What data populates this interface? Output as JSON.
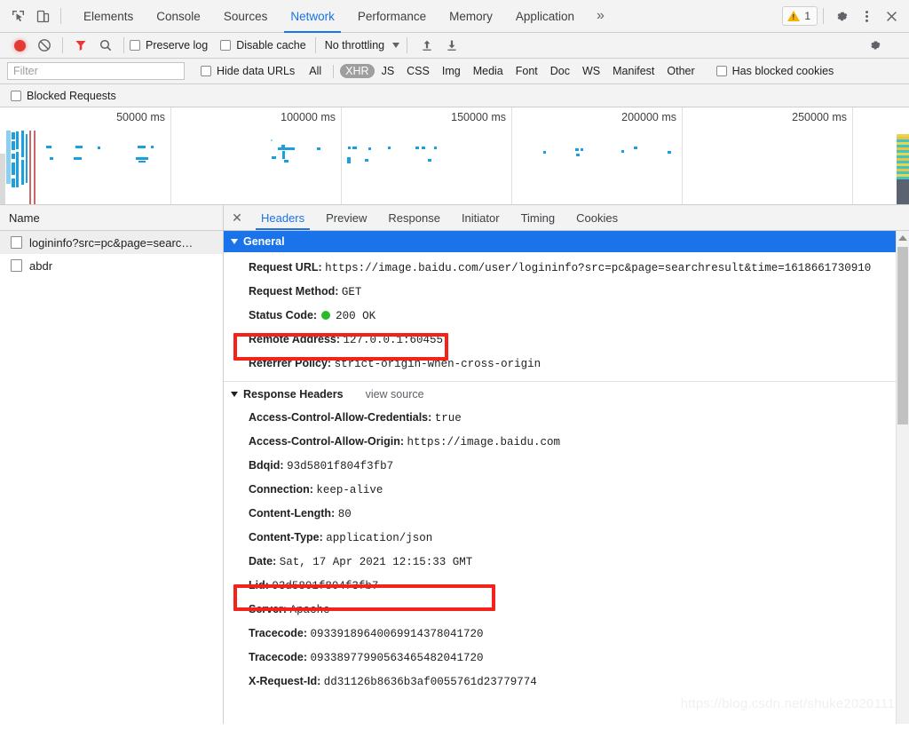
{
  "tabbar": {
    "icons": [
      "inspect-element-icon",
      "device-toolbar-icon"
    ],
    "tabs": [
      {
        "label": "Elements",
        "active": false
      },
      {
        "label": "Console",
        "active": false
      },
      {
        "label": "Sources",
        "active": false
      },
      {
        "label": "Network",
        "active": true
      },
      {
        "label": "Performance",
        "active": false
      },
      {
        "label": "Memory",
        "active": false
      },
      {
        "label": "Application",
        "active": false
      }
    ],
    "more_label": "»",
    "warning_count": "1",
    "settings_label": "⚙",
    "kebab_label": "⋮",
    "close_label": "✕"
  },
  "controls": {
    "record_title": "record-button",
    "clear_title": "clear-button",
    "filter_title": "filter-button",
    "search_title": "search-button",
    "preserve_log": "Preserve log",
    "disable_cache": "Disable cache",
    "throttling": "No throttling",
    "import_title": "import-har",
    "export_title": "export-har",
    "settings_title": "network-settings"
  },
  "filterbar": {
    "placeholder": "Filter",
    "value": "",
    "hide_data_urls": "Hide data URLs",
    "types": [
      {
        "label": "All",
        "selected": false
      },
      {
        "label": "XHR",
        "selected": true
      },
      {
        "label": "JS",
        "selected": false
      },
      {
        "label": "CSS",
        "selected": false
      },
      {
        "label": "Img",
        "selected": false
      },
      {
        "label": "Media",
        "selected": false
      },
      {
        "label": "Font",
        "selected": false
      },
      {
        "label": "Doc",
        "selected": false
      },
      {
        "label": "WS",
        "selected": false
      },
      {
        "label": "Manifest",
        "selected": false
      },
      {
        "label": "Other",
        "selected": false
      }
    ],
    "has_blocked_cookies": "Has blocked cookies",
    "blocked_requests": "Blocked Requests"
  },
  "overview": {
    "ticks": [
      "50000 ms",
      "100000 ms",
      "150000 ms",
      "200000 ms",
      "250000 ms"
    ],
    "bar_color": "#1a9fe0",
    "marker_color": "#b33333"
  },
  "requests": {
    "column_header": "Name",
    "rows": [
      {
        "name": "logininfo?src=pc&page=searc…",
        "selected": true
      },
      {
        "name": "abdr",
        "selected": false
      }
    ]
  },
  "detail": {
    "close_label": "✕",
    "tabs": [
      {
        "label": "Headers",
        "active": true
      },
      {
        "label": "Preview",
        "active": false
      },
      {
        "label": "Response",
        "active": false
      },
      {
        "label": "Initiator",
        "active": false
      },
      {
        "label": "Timing",
        "active": false
      },
      {
        "label": "Cookies",
        "active": false
      }
    ],
    "general": {
      "title": "General",
      "rows": [
        {
          "key": "Request URL:",
          "value": "https://image.baidu.com/user/logininfo?src=pc&page=searchresult&time=1618661730910",
          "highlight": false
        },
        {
          "key": "Request Method:",
          "value": "GET",
          "highlight": true
        },
        {
          "key": "Status Code:",
          "value": "200 OK",
          "status_dot": true,
          "highlight": false
        },
        {
          "key": "Remote Address:",
          "value": "127.0.0.1:60455",
          "highlight": false
        },
        {
          "key": "Referrer Policy:",
          "value": "strict-origin-when-cross-origin",
          "highlight": false
        }
      ]
    },
    "response_headers": {
      "title": "Response Headers",
      "view_source": "view source",
      "rows": [
        {
          "key": "Access-Control-Allow-Credentials:",
          "value": "true",
          "highlight": false
        },
        {
          "key": "Access-Control-Allow-Origin:",
          "value": "https://image.baidu.com",
          "highlight": false
        },
        {
          "key": "Bdqid:",
          "value": "93d5801f804f3fb7",
          "highlight": false
        },
        {
          "key": "Connection:",
          "value": "keep-alive",
          "highlight": false
        },
        {
          "key": "Content-Length:",
          "value": "80",
          "highlight": false
        },
        {
          "key": "Content-Type:",
          "value": "application/json",
          "highlight": true
        },
        {
          "key": "Date:",
          "value": "Sat, 17 Apr 2021 12:15:33 GMT",
          "highlight": false
        },
        {
          "key": "Lid:",
          "value": "93d5801f804f3fb7",
          "highlight": false
        },
        {
          "key": "Server:",
          "value": "Apache",
          "highlight": false
        },
        {
          "key": "Tracecode:",
          "value": "09339189640069914378041720",
          "highlight": false
        },
        {
          "key": "Tracecode:",
          "value": "09338977990563465482041720",
          "highlight": false
        },
        {
          "key": "X-Request-Id:",
          "value": "dd31126b8636b3af0055761d23779774",
          "highlight": false
        }
      ]
    }
  },
  "watermark": "https://blog.csdn.net/shuke2020111",
  "colors": {
    "accent": "#1a73e8",
    "highlight": "#f5221b",
    "record": "#e53935",
    "status_ok": "#2aba2a",
    "warning": "#f5b400"
  }
}
